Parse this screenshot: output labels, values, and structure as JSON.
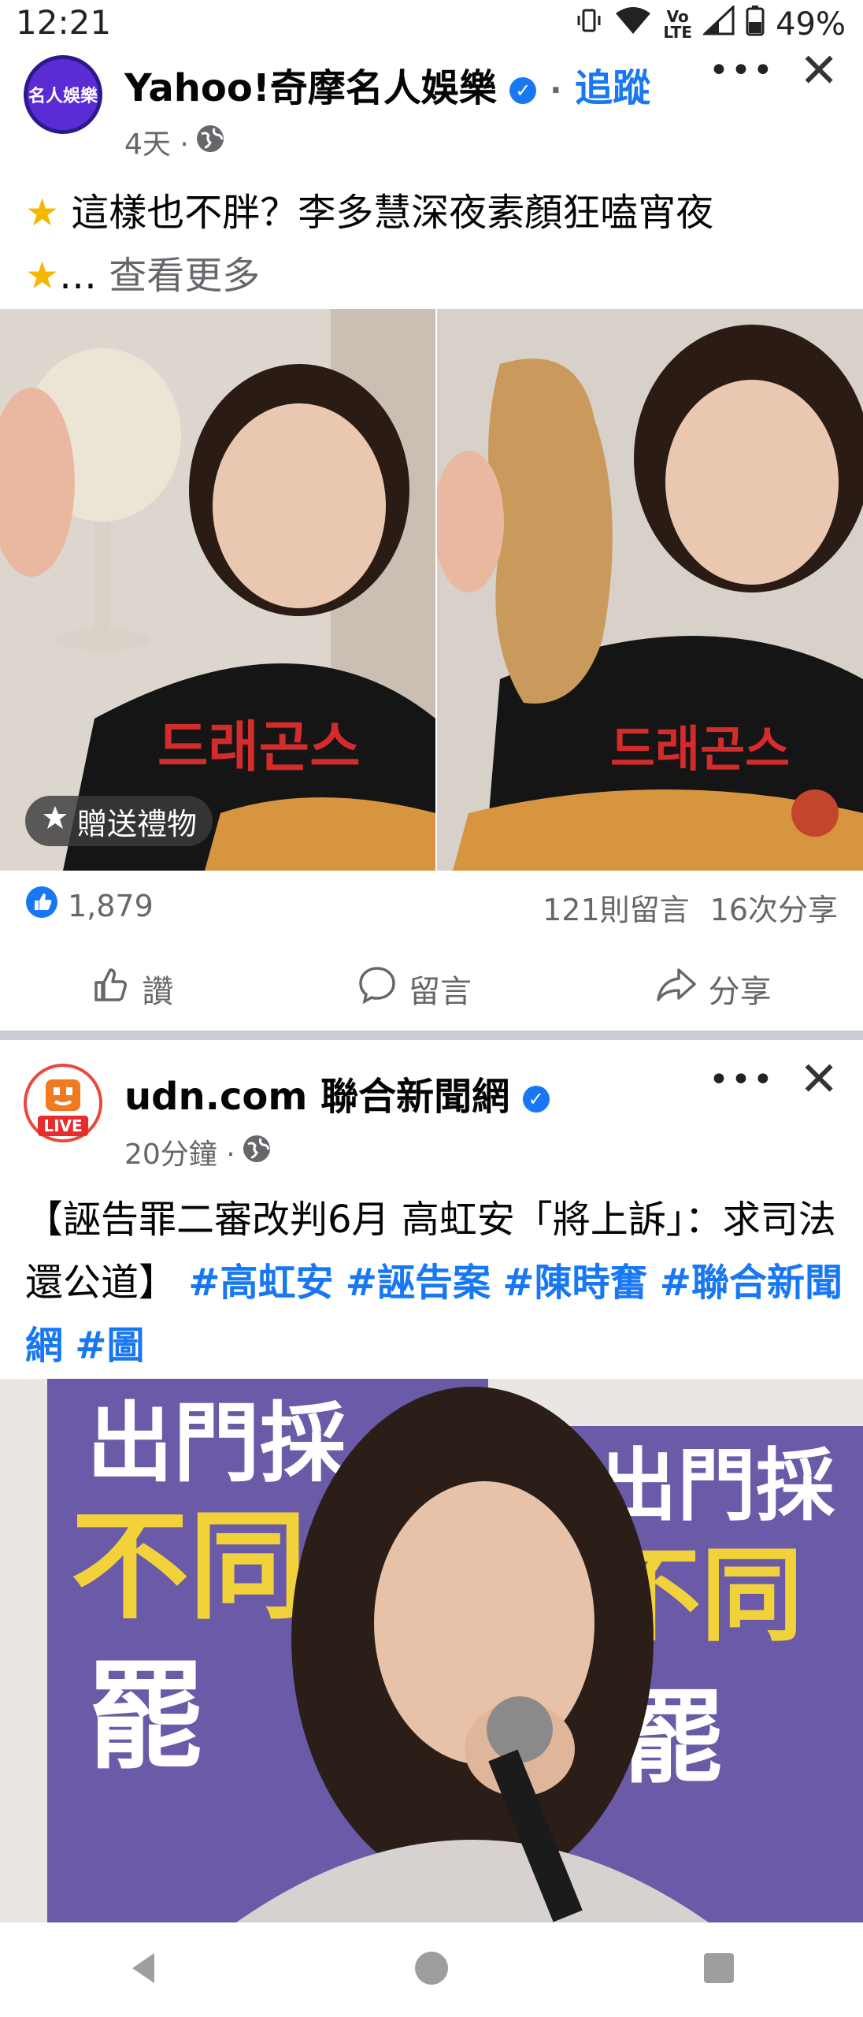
{
  "status_bar": {
    "time": "12:21",
    "battery": "49%",
    "network": "LTE"
  },
  "post1": {
    "page_name": "Yahoo!奇摩名人娛樂",
    "avatar_text": "名人娛樂",
    "follow_label": "追蹤",
    "follow_sep": "·",
    "timestamp": "4天 ·",
    "text_line1": "這樣也不胖？李多慧深夜素顏狂嗑宵夜",
    "text_line2_prefix": "…",
    "see_more": "查看更多",
    "gift_label": "贈送禮物",
    "shirt_text": "드래곤스",
    "reaction_count": "1,879",
    "comments": "121則留言",
    "shares": "16次分享",
    "actions": {
      "like": "讚",
      "comment": "留言",
      "share": "分享"
    }
  },
  "post2": {
    "page_name": "udn.com 聯合新聞網",
    "avatar_badge": "LIVE",
    "timestamp": "20分鐘 ·",
    "text_plain": "【誣告罪二審改判6月 高虹安「將上訴」：求司法還公道】",
    "hashtags": [
      "#高虹安",
      "#誣告案",
      "#陳時奮",
      "#聯合新聞網",
      "#圖"
    ],
    "banner_lines": [
      "出門採",
      "不同",
      "罷"
    ]
  },
  "colors": {
    "facebook_blue": "#1877f2",
    "secondary_text": "#65676b",
    "divider": "#c9ccd1"
  },
  "icons": [
    "wifi-icon",
    "signal-icon",
    "battery-icon",
    "vibrate-icon",
    "globe-icon",
    "star-icon",
    "like-icon",
    "comment-icon",
    "share-icon",
    "gift-icon",
    "back-icon",
    "home-icon",
    "recents-icon"
  ]
}
